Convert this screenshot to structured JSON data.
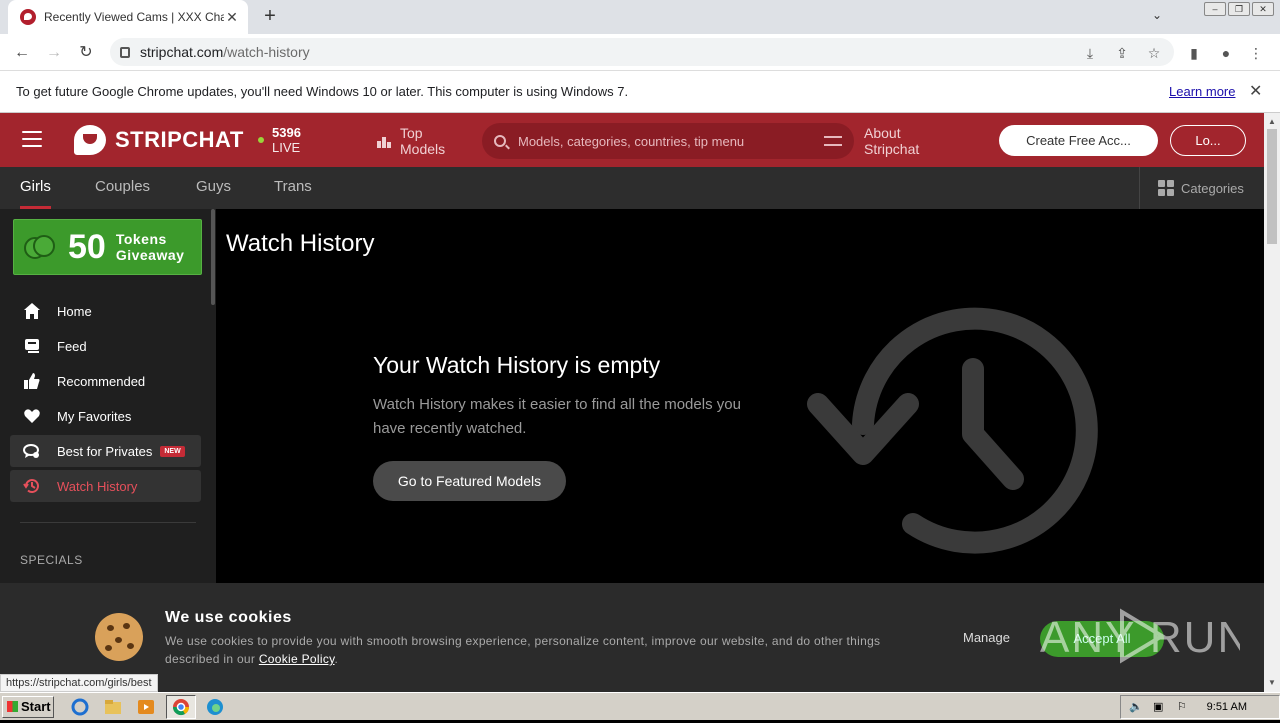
{
  "browser": {
    "tab_title": "Recently Viewed Cams | XXX Chat, F",
    "url_host": "stripchat.com",
    "url_path": "/watch-history",
    "infobar_message": "To get future Google Chrome updates, you'll need Windows 10 or later. This computer is using Windows 7.",
    "infobar_link": "Learn more",
    "status_url": "https://stripchat.com/girls/best"
  },
  "header": {
    "logo_text": "STRIPCHAT",
    "live_count": "5396",
    "live_label": "LIVE",
    "top_models_line1": "Top",
    "top_models_line2": "Models",
    "search_placeholder": "Models, categories, countries, tip menu",
    "about_line1": "About",
    "about_line2": "Stripchat",
    "create_account": "Create Free Acc...",
    "login": "Lo..."
  },
  "category_nav": {
    "tabs": [
      "Girls",
      "Couples",
      "Guys",
      "Trans"
    ],
    "active": "Girls",
    "categories_label": "Categories"
  },
  "sidebar": {
    "promo_number": "50",
    "promo_line1": "Tokens",
    "promo_line2": "Giveaway",
    "items": [
      {
        "label": "Home",
        "icon": "home-icon"
      },
      {
        "label": "Feed",
        "icon": "feed-icon"
      },
      {
        "label": "Recommended",
        "icon": "thumbs-up-icon"
      },
      {
        "label": "My Favorites",
        "icon": "heart-icon"
      },
      {
        "label": "Best for Privates",
        "icon": "privates-icon",
        "badge": "NEW"
      },
      {
        "label": "Watch History",
        "icon": "history-icon",
        "selected": true
      }
    ],
    "specials_heading": "SPECIALS"
  },
  "main": {
    "page_title": "Watch History",
    "empty_heading": "Your Watch History is empty",
    "empty_text": "Watch History makes it easier to find all the models you have recently watched.",
    "cta_button": "Go to Featured Models"
  },
  "cookie_banner": {
    "heading": "We use cookies",
    "text": "We use cookies to provide you with smooth browsing experience, personalize content, improve our website, and do other things described in our",
    "policy_link": "Cookie Policy",
    "manage": "Manage",
    "accept": "Accept All"
  },
  "taskbar": {
    "start": "Start",
    "clock": "9:51 AM"
  },
  "watermark": "ANY RUN",
  "colors": {
    "brand_red": "#a2252d",
    "promo_green": "#3c9a2b",
    "selected_text": "#e6505b"
  }
}
